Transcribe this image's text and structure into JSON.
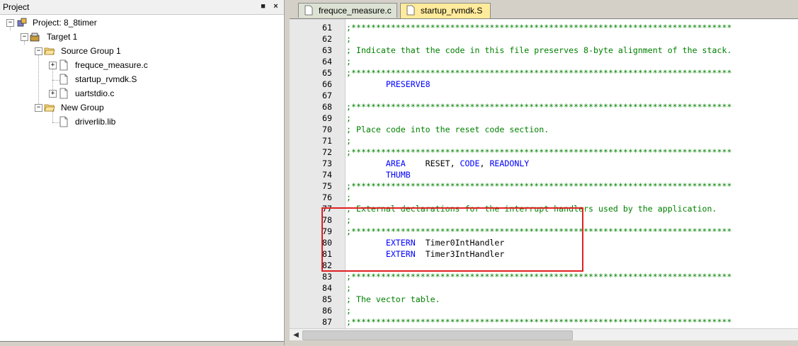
{
  "project_panel": {
    "title": "Project",
    "pin_glyph": "‑¦",
    "close_glyph": "×",
    "tree": [
      {
        "label": "Project: 8_8timer",
        "icon": "project-icon",
        "expander": "−"
      },
      {
        "label": "Target 1",
        "icon": "target-icon",
        "expander": "−"
      },
      {
        "label": "Source Group 1",
        "icon": "folder-open-icon",
        "expander": "−"
      },
      {
        "label": "frequce_measure.c",
        "icon": "file-icon",
        "expander": "+"
      },
      {
        "label": "startup_rvmdk.S",
        "icon": "file-icon",
        "expander": ""
      },
      {
        "label": "uartstdio.c",
        "icon": "file-icon",
        "expander": "+"
      },
      {
        "label": "New Group",
        "icon": "folder-open-icon",
        "expander": "−"
      },
      {
        "label": "driverlib.lib",
        "icon": "file-icon",
        "expander": ""
      }
    ]
  },
  "editor": {
    "tabs": [
      {
        "label": "frequce_measure.c",
        "active": false
      },
      {
        "label": "startup_rvmdk.S",
        "active": true
      }
    ],
    "lines": [
      {
        "n": "61",
        "text": ";*****************************************************************************"
      },
      {
        "n": "62",
        "text": ";"
      },
      {
        "n": "63",
        "text": "; Indicate that the code in this file preserves 8-byte alignment of the stack."
      },
      {
        "n": "64",
        "text": ";"
      },
      {
        "n": "65",
        "text": ";*****************************************************************************"
      },
      {
        "n": "66",
        "kw": "PRESERVE8",
        "rest": ""
      },
      {
        "n": "67",
        "text": ""
      },
      {
        "n": "68",
        "text": ";*****************************************************************************"
      },
      {
        "n": "69",
        "text": ";"
      },
      {
        "n": "70",
        "text": "; Place code into the reset code section."
      },
      {
        "n": "71",
        "text": ";"
      },
      {
        "n": "72",
        "text": ";*****************************************************************************"
      },
      {
        "n": "73",
        "kw": "AREA",
        "rest": "    RESET, ",
        "kw2": "CODE",
        "rest2": ", ",
        "kw3": "READONLY"
      },
      {
        "n": "74",
        "kw": "THUMB",
        "rest": ""
      },
      {
        "n": "75",
        "text": ";*****************************************************************************"
      },
      {
        "n": "76",
        "text": ";"
      },
      {
        "n": "77",
        "text": "; External declarations for the interrupt handlers used by the application."
      },
      {
        "n": "78",
        "text": ";"
      },
      {
        "n": "79",
        "text": ";*****************************************************************************"
      },
      {
        "n": "80",
        "kw": "EXTERN",
        "rest": "  Timer0IntHandler"
      },
      {
        "n": "81",
        "kw": "EXTERN",
        "rest": "  Timer3IntHandler"
      },
      {
        "n": "82",
        "text": ""
      },
      {
        "n": "83",
        "text": ";*****************************************************************************"
      },
      {
        "n": "84",
        "text": ";"
      },
      {
        "n": "85",
        "text": "; The vector table."
      },
      {
        "n": "86",
        "text": ";"
      },
      {
        "n": "87",
        "text": ";*****************************************************************************"
      }
    ]
  },
  "colors": {
    "keyword": "#0000ff",
    "comment": "#008000",
    "highlight_box": "#e02020",
    "active_tab": "#ffeb9b"
  }
}
